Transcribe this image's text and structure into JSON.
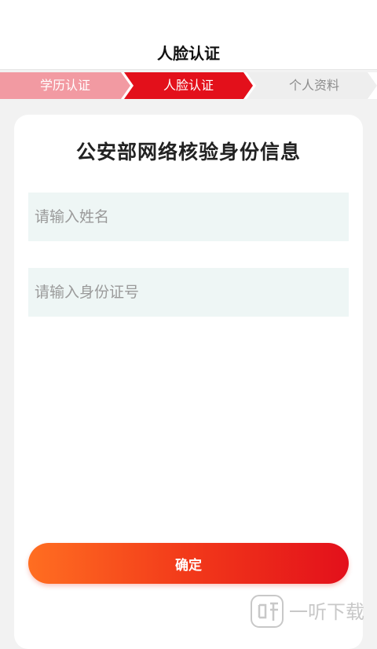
{
  "header": {
    "title": "人脸认证"
  },
  "steps": {
    "items": [
      {
        "label": "学历认证",
        "state": "completed"
      },
      {
        "label": "人脸认证",
        "state": "active"
      },
      {
        "label": "个人资料",
        "state": "pending"
      }
    ]
  },
  "form": {
    "title": "公安部网络核验身份信息",
    "name_input": {
      "value": "",
      "placeholder": "请输入姓名"
    },
    "id_input": {
      "value": "",
      "placeholder": "请输入身份证号"
    },
    "confirm_label": "确定"
  },
  "watermark": {
    "text": "一听下载"
  },
  "colors": {
    "completed_step": "#f29aa2",
    "active_step": "#e3101b",
    "pending_step": "#eeeeee",
    "button_gradient_start": "#ff6e21",
    "button_gradient_end": "#e3101b"
  }
}
